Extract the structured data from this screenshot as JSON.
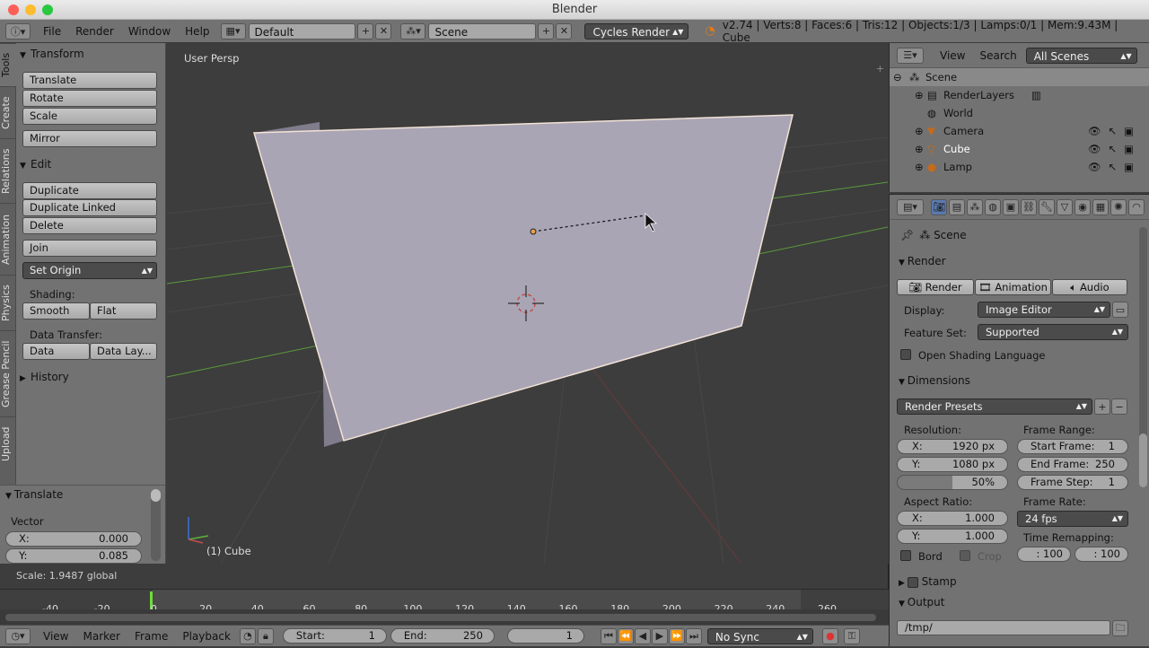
{
  "window": {
    "title": "Blender"
  },
  "infobar": {
    "menus": [
      "File",
      "Render",
      "Window",
      "Help"
    ],
    "screen_layout": "Default",
    "scene": "Scene",
    "render_engine": "Cycles Render",
    "stats": "v2.74 | Verts:8 | Faces:6 | Tris:12 | Objects:1/3 | Lamps:0/1 | Mem:9.43M | Cube"
  },
  "tool_tabs": [
    "Tools",
    "Create",
    "Relations",
    "Animation",
    "Physics",
    "Grease Pencil",
    "Upload"
  ],
  "toolshelf": {
    "transform": {
      "title": "Transform",
      "buttons": [
        "Translate",
        "Rotate",
        "Scale",
        "Mirror"
      ]
    },
    "edit": {
      "title": "Edit",
      "buttons": [
        "Duplicate",
        "Duplicate Linked",
        "Delete",
        "Join"
      ],
      "set_origin": "Set Origin",
      "shading_label": "Shading:",
      "smooth": "Smooth",
      "flat": "Flat",
      "data_transfer_label": "Data Transfer:",
      "data": "Data",
      "data_layers": "Data Lay..."
    },
    "history": {
      "title": "History"
    }
  },
  "operator": {
    "title": "Translate",
    "vector_label": "Vector",
    "x_label": "X:",
    "x_value": "0.000",
    "y_label": "Y:",
    "y_value": "0.085"
  },
  "viewport": {
    "view_name": "User Persp",
    "object_label": "(1) Cube",
    "status": "Scale: 1.9487 global"
  },
  "timeline": {
    "ticks": [
      "-40",
      "-20",
      "0",
      "20",
      "40",
      "60",
      "80",
      "100",
      "120",
      "140",
      "160",
      "180",
      "200",
      "220",
      "240",
      "260"
    ],
    "menus": [
      "View",
      "Marker",
      "Frame",
      "Playback"
    ],
    "start_label": "Start:",
    "start": "1",
    "end_label": "End:",
    "end": "250",
    "current": "1",
    "sync": "No Sync"
  },
  "outliner": {
    "menus": [
      "View",
      "Search"
    ],
    "filter": "All Scenes",
    "items": [
      "Scene",
      "RenderLayers",
      "World",
      "Camera",
      "Cube",
      "Lamp"
    ]
  },
  "properties": {
    "context": "Scene",
    "render_panel": "Render",
    "render_btn": "Render",
    "animation_btn": "Animation",
    "audio_btn": "Audio",
    "display_label": "Display:",
    "display_value": "Image Editor",
    "feature_label": "Feature Set:",
    "feature_value": "Supported",
    "osl_label": "Open Shading Language",
    "dimensions_panel": "Dimensions",
    "render_presets": "Render Presets",
    "resolution_label": "Resolution:",
    "res_x_label": "X:",
    "res_x": "1920 px",
    "res_y_label": "Y:",
    "res_y": "1080 px",
    "res_pct": "50%",
    "frame_range_label": "Frame Range:",
    "start_frame_label": "Start Frame:",
    "start_frame": "1",
    "end_frame_label": "End Frame:",
    "end_frame": "250",
    "frame_step_label": "Frame Step:",
    "frame_step": "1",
    "aspect_label": "Aspect Ratio:",
    "asp_x_label": "X:",
    "asp_x": "1.000",
    "asp_y_label": "Y:",
    "asp_y": "1.000",
    "frame_rate_label": "Frame Rate:",
    "frame_rate": "24 fps",
    "time_remap_label": "Time Remapping:",
    "remap_old": ": 100",
    "remap_new": ": 100",
    "bord": "Bord",
    "crop": "Crop",
    "stamp_panel": "Stamp",
    "output_panel": "Output",
    "output_path": "/tmp/"
  },
  "colors": {
    "header": "#727272",
    "viewport_bg": "#3d3d3d",
    "cube": "#a9a5b5",
    "accent_green": "#6fdc3a"
  }
}
